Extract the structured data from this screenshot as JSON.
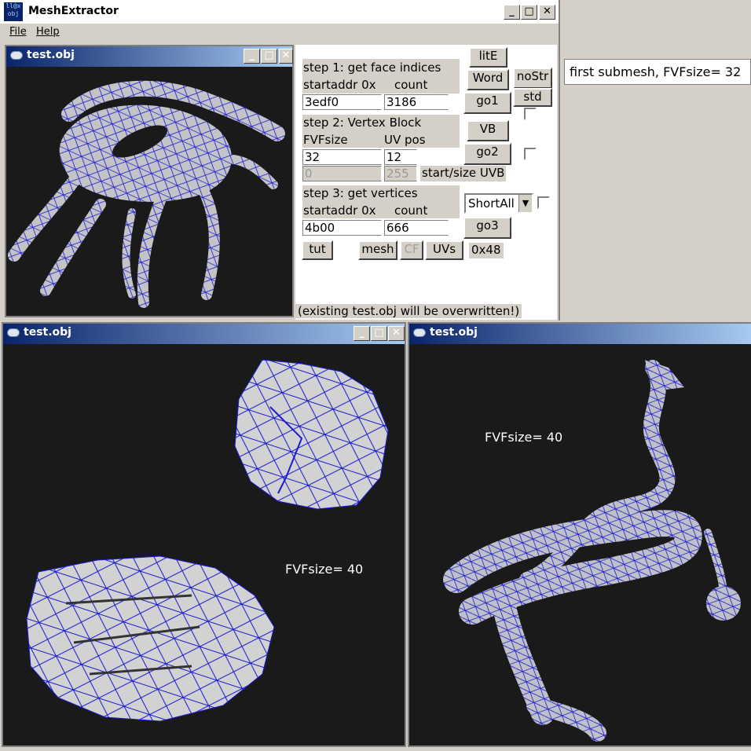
{
  "app": {
    "title": "MeshExtractor",
    "icon_text": "ll@x obj"
  },
  "menu": {
    "file": "File",
    "help": "Help"
  },
  "viewports": {
    "top_left": {
      "title": "test.obj"
    },
    "bottom_left": {
      "title": "test.obj",
      "overlay": "FVFsize= 40"
    },
    "bottom_right": {
      "title": "test.obj",
      "overlay": "FVFsize= 40"
    }
  },
  "step1": {
    "heading": "step 1: get face indices",
    "startaddr_label": "startaddr 0x",
    "count_label": "count",
    "startaddr": "3edf0",
    "count": "3186"
  },
  "step2": {
    "heading": "step 2: Vertex Block",
    "fvf_label": "FVFsize",
    "uvpos_label": "UV pos",
    "fvfsize": "32",
    "uvpos": "12",
    "uvb_start": "0",
    "uvb_size": "255",
    "uvb_label": "start/size UVB"
  },
  "step3": {
    "heading": "step 3: get vertices",
    "startaddr_label": "startaddr 0x",
    "count_label": "count",
    "startaddr": "4b00",
    "count": "666",
    "mode": "ShortAll"
  },
  "buttons": {
    "lite": "litE",
    "word": "Word",
    "nostr": "noStr",
    "std": "std",
    "go1": "go1",
    "vb": "VB",
    "go2": "go2",
    "go3": "go3",
    "tut": "tut",
    "mesh": "mesh",
    "cf": "CF",
    "uvs": "UVs"
  },
  "hex_readout": "0x48",
  "warning": "(existing test.obj will be overwritten!)",
  "info_box": "first submesh,  FVFsize= 32",
  "colors": {
    "wire": "#1a1ad0",
    "mesh": "#c8c8c8",
    "viewport_bg": "#1a1a1a",
    "title_grad_start": "#0a246a",
    "title_grad_end": "#a6caf0"
  }
}
